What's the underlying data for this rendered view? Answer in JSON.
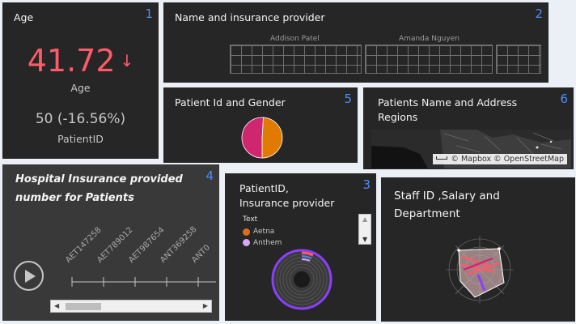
{
  "colors": {
    "accent_number": "#4d8cff",
    "kpi_red": "#ff5a6a",
    "tile_bg": "#262626",
    "page_bg": "#eaf0f6"
  },
  "tiles": {
    "age": {
      "title": "Age",
      "number": "1",
      "value": "41.72",
      "trend_icon": "arrow-down-icon",
      "trend_glyph": "↓",
      "value_label": "Age",
      "compare": "50 (-16.56%)",
      "compare_label": "PatientID"
    },
    "insurance_names": {
      "title": "Name and insurance provider",
      "number": "2",
      "columns": [
        "Addison Patel",
        "Amanda Nguyen"
      ]
    },
    "insurance_table": {
      "title_line1": "PatientID,",
      "title_line2": "Insurance provider",
      "number": "3",
      "legend_title": "Text",
      "legend": [
        {
          "label": "Aetna",
          "color": "#e06c1c"
        },
        {
          "label": "Anthem",
          "color": "#d9a8f5"
        }
      ]
    },
    "hospital": {
      "title_line1": "Hospital Insurance provided",
      "title_line2": "number for Patients",
      "number": "4",
      "axis_labels": [
        "AET147258",
        "AET789012",
        "AET987654",
        "ANT369258",
        "ANT0"
      ]
    },
    "gender": {
      "title": "Patient Id and Gender",
      "number": "5",
      "pie": [
        {
          "label": "",
          "value": 0.49,
          "color": "#e07b00"
        },
        {
          "label": "",
          "value": 0.51,
          "color": "#d02670"
        }
      ]
    },
    "regions": {
      "title_line1": "Patients Name and Address",
      "title_line2": "Regions",
      "number": "6",
      "attribution": "© Mapbox © OpenStreetMap"
    },
    "staff": {
      "title_line1": "Staff ID ,Salary and",
      "title_line2": "Department"
    }
  }
}
